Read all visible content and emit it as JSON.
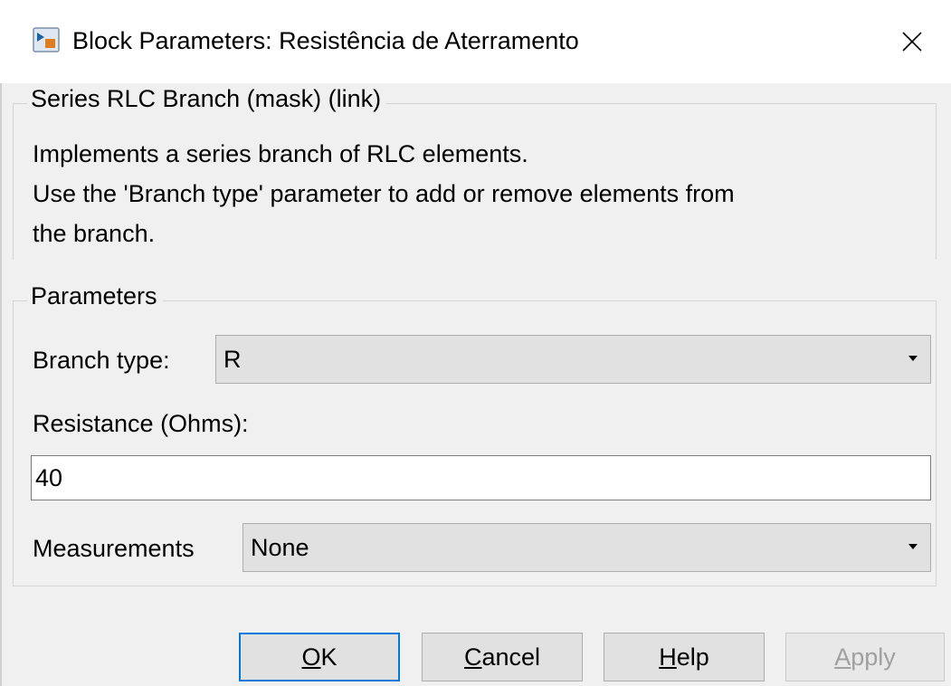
{
  "window": {
    "title": "Block Parameters: Resistência de Aterramento",
    "close_glyph": "✕"
  },
  "description": {
    "legend": "Series RLC Branch (mask) (link)",
    "lines": [
      "Implements a series branch of RLC elements.",
      "Use the 'Branch type' parameter to add or remove elements from",
      "the branch."
    ]
  },
  "parameters": {
    "legend": "Parameters",
    "branch_type": {
      "label": "Branch type:",
      "value": "R"
    },
    "resistance": {
      "label": "Resistance (Ohms):",
      "value": "40"
    },
    "measurements": {
      "label": "Measurements",
      "value": "None"
    }
  },
  "buttons": {
    "ok": {
      "mnemonic": "O",
      "rest": "K"
    },
    "cancel": {
      "mnemonic": "C",
      "rest": "ancel"
    },
    "help": {
      "mnemonic": "H",
      "rest": "elp"
    },
    "apply": {
      "mnemonic": "A",
      "rest": "pply"
    }
  },
  "colors": {
    "accent": "#0078d7",
    "window_bg": "#f0f0f0",
    "titlebar_bg": "#ffffff"
  }
}
